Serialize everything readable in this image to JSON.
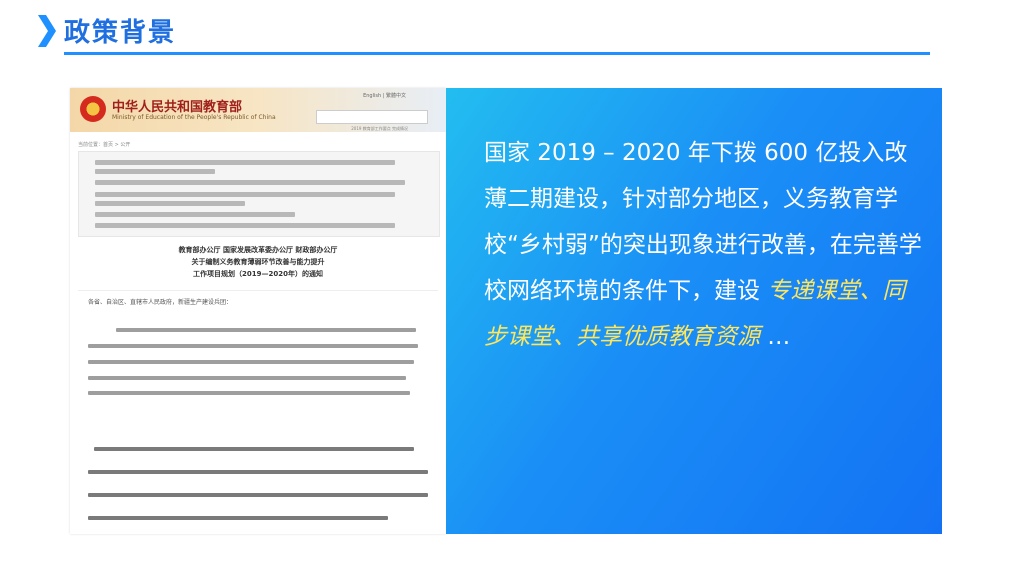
{
  "header": {
    "title": "政策背景"
  },
  "doc": {
    "ministry_cn": "中华人民共和国教育部",
    "ministry_en": "Ministry of Education of the People's Republic of China",
    "top_links": "English  |  繁體中文",
    "banner_note": "2019 教育部工作要点 完成情况",
    "breadcrumb": "当前位置：首页 > 公开",
    "heading_lines": [
      "教育部办公厅 国家发展改革委办公厅 财政部办公厅",
      "关于编制义务教育薄弱环节改善与能力提升",
      "工作项目规划（2019—2020年）的通知"
    ],
    "source": "各省、自治区、直辖市人民政府，新疆生产建设兵团："
  },
  "panel": {
    "text_before": "国家 2019 – 2020 年下拨 600 亿投入改薄二期建设，针对部分地区，义务教育学校“乡村弱”的突出现象进行改善，在完善学校网络环境的条件下，建设 ",
    "highlight": "专递课堂、同步课堂、共享优质教育资源",
    "text_after": " …",
    "highlight_color": "#ffe65c"
  },
  "colors": {
    "accent": "#1f6fe0",
    "panel_start": "#23bdf0",
    "panel_end": "#1372f4"
  }
}
